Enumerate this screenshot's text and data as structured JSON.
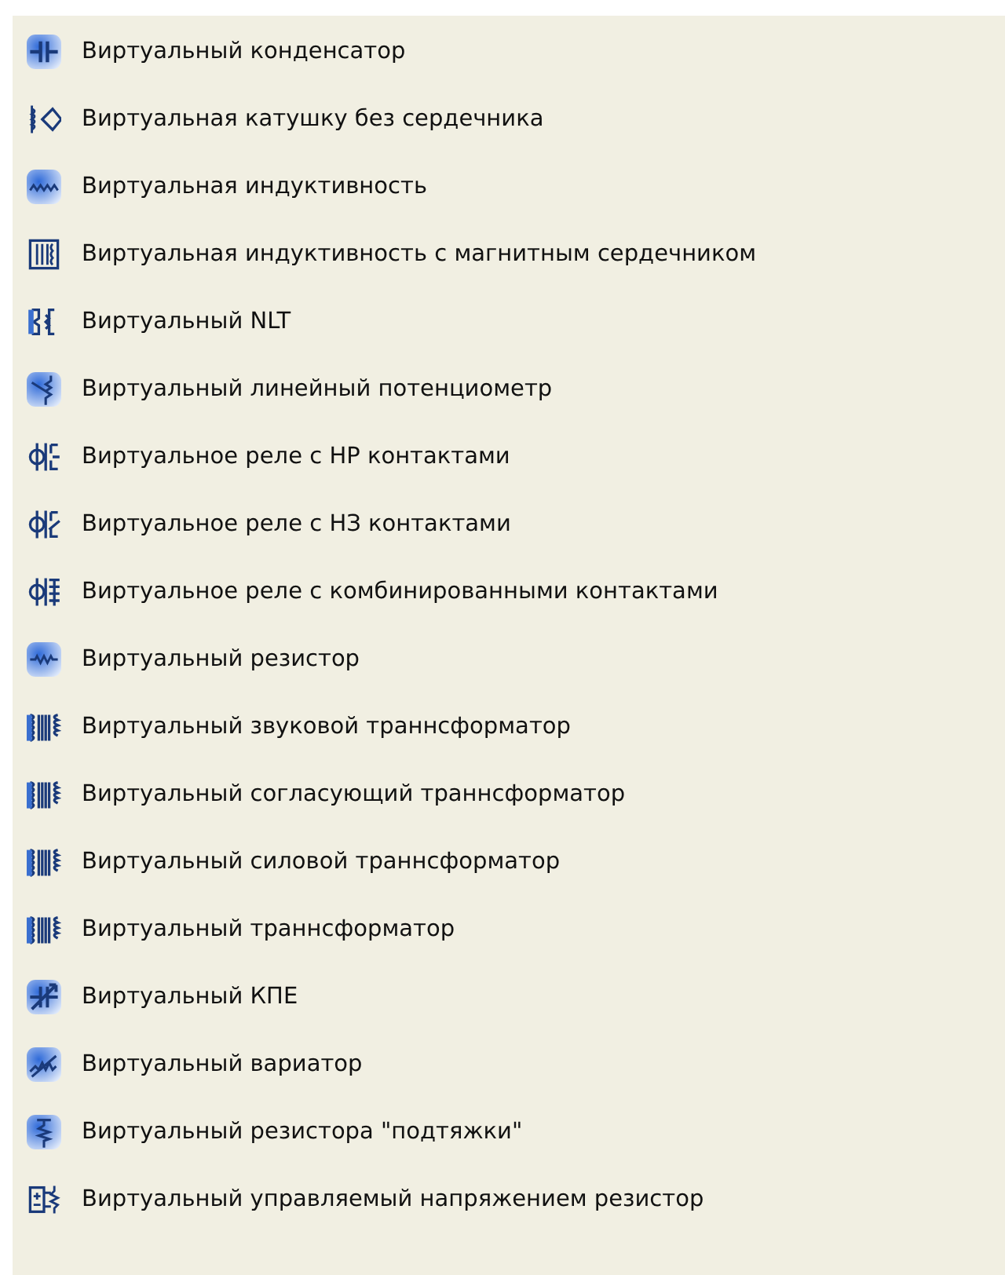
{
  "items": [
    {
      "kind": "capacitor",
      "label": "Виртуальный конденсатор"
    },
    {
      "kind": "diamond",
      "label": "Виртуальная катушку без сердечника"
    },
    {
      "kind": "coil",
      "label": "Виртуальная индуктивность"
    },
    {
      "kind": "core",
      "label": "Виртуальная индуктивность с магнитным сердечником"
    },
    {
      "kind": "nlt",
      "label": "Виртуальный NLT"
    },
    {
      "kind": "pot",
      "label": "Виртуальный линейный потенциометр"
    },
    {
      "kind": "relay_no",
      "label": "Виртуальное реле с НР контактами"
    },
    {
      "kind": "relay_nc",
      "label": "Виртуальное реле с НЗ контактами"
    },
    {
      "kind": "relay_combo",
      "label": "Виртуальное реле с комбинированными контактами"
    },
    {
      "kind": "resistor",
      "label": "Виртуальный резистор"
    },
    {
      "kind": "transformer",
      "label": "Виртуальный звуковой траннсформатор"
    },
    {
      "kind": "transformer",
      "label": "Виртуальный согласующий траннсформатор"
    },
    {
      "kind": "transformer",
      "label": "Виртуальный силовой траннсформатор"
    },
    {
      "kind": "transformer",
      "label": "Виртуальный траннсформатор"
    },
    {
      "kind": "kpe",
      "label": "Виртуальный КПЕ"
    },
    {
      "kind": "varistor",
      "label": "Виртуальный вариатор"
    },
    {
      "kind": "pullup",
      "label": "Виртуальный резистора \"подтяжки\""
    },
    {
      "kind": "vcr",
      "label": "Виртуальный управляемый напряжением резистор"
    }
  ]
}
